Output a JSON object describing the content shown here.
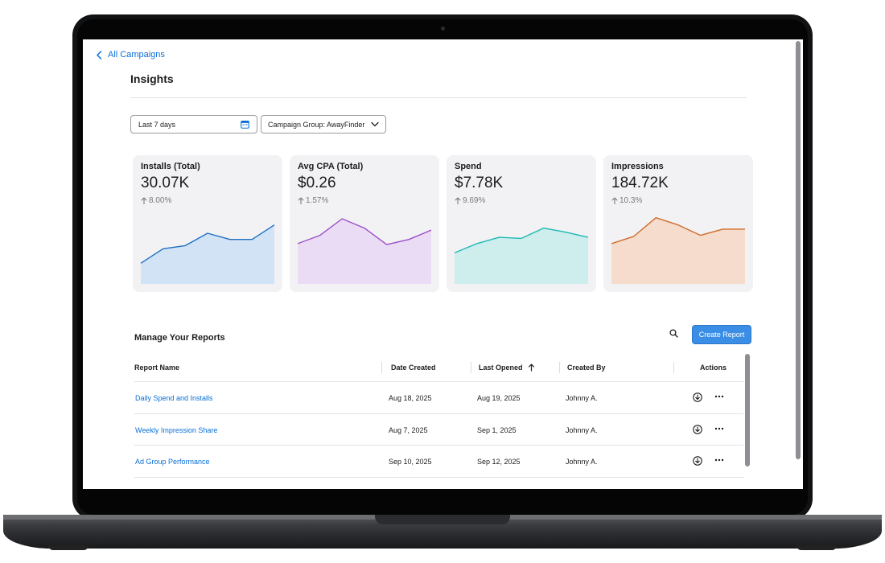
{
  "nav": {
    "back_label": "All Campaigns"
  },
  "page": {
    "title": "Insights"
  },
  "filters": {
    "date_range": "Last 7 days",
    "campaign_group": "Campaign Group: AwayFinder"
  },
  "metrics": [
    {
      "label": "Installs (Total)",
      "value": "30.07K",
      "change": "8.00%",
      "color": "#1f6fc2",
      "fill": "#d3e3f6",
      "trend": [
        2.0,
        3.4,
        3.7,
        4.9,
        4.3,
        4.3,
        5.7
      ]
    },
    {
      "label": "Avg CPA (Total)",
      "value": "$0.26",
      "change": "1.57%",
      "color": "#9b4fc7",
      "fill": "#eadcf4",
      "trend": [
        3.9,
        4.7,
        6.3,
        5.4,
        3.8,
        4.3,
        5.2
      ]
    },
    {
      "label": "Spend",
      "value": "$7.78K",
      "change": "9.69%",
      "color": "#1db8b4",
      "fill": "#cdeeed",
      "trend": [
        3.0,
        3.9,
        4.5,
        4.4,
        5.4,
        5.0,
        4.5
      ]
    },
    {
      "label": "Impressions",
      "value": "184.72K",
      "change": "10.3%",
      "color": "#d06a2a",
      "fill": "#f5dccd",
      "trend": [
        3.9,
        4.6,
        6.4,
        5.7,
        4.7,
        5.3,
        5.3
      ]
    }
  ],
  "reports": {
    "title": "Manage Your Reports",
    "create_label": "Create Report",
    "columns": [
      "Report Name",
      "Date Created",
      "Last Opened",
      "Created By",
      "Actions"
    ],
    "rows": [
      {
        "name": "Daily Spend and Installs",
        "created": "Aug 18, 2025",
        "opened": "Aug 19, 2025",
        "by": "Johnny A."
      },
      {
        "name": "Weekly Impression Share",
        "created": "Aug 7, 2025",
        "opened": "Sep 1, 2025",
        "by": "Johnny A."
      },
      {
        "name": "Ad Group Performance",
        "created": "Sep 10, 2025",
        "opened": "Sep 12, 2025",
        "by": "Johnny A."
      }
    ]
  }
}
